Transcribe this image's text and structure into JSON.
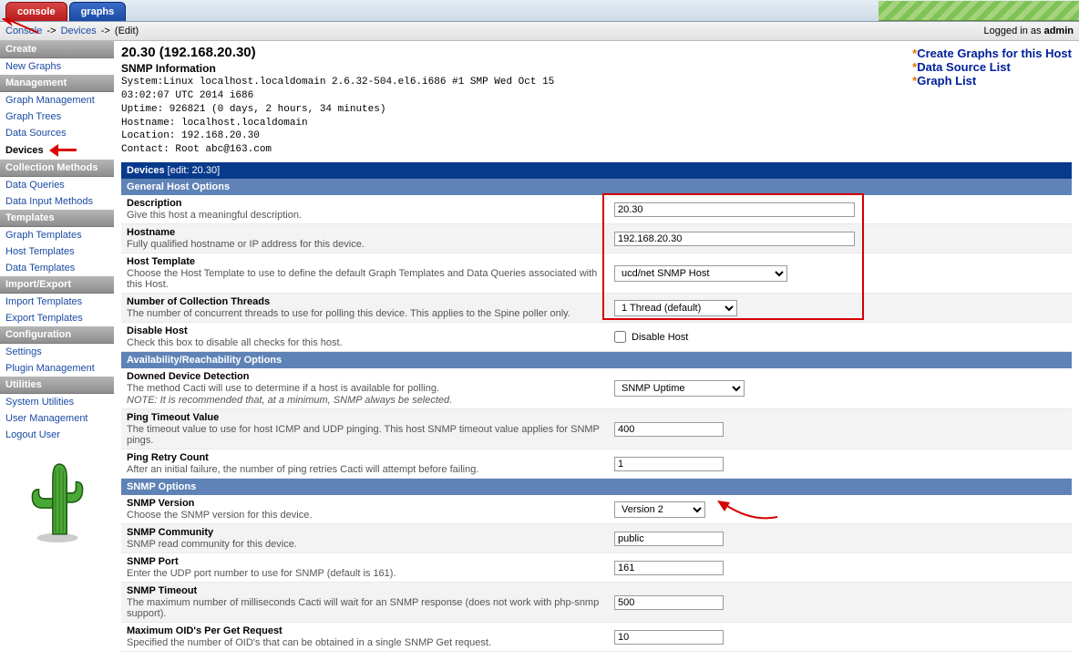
{
  "tabs": {
    "console": "console",
    "graphs": "graphs"
  },
  "breadcrumb": {
    "console": "Console",
    "sep": " -> ",
    "devices": "Devices",
    "edit": "(Edit)",
    "logged_in_as_prefix": "Logged in as ",
    "user": "admin"
  },
  "sidebar": {
    "create": "Create",
    "new_graphs": "New Graphs",
    "management": "Management",
    "graph_management": "Graph Management",
    "graph_trees": "Graph Trees",
    "data_sources": "Data Sources",
    "devices": "Devices",
    "collection_methods": "Collection Methods",
    "data_queries": "Data Queries",
    "data_input_methods": "Data Input Methods",
    "templates": "Templates",
    "graph_templates": "Graph Templates",
    "host_templates": "Host Templates",
    "data_templates": "Data Templates",
    "import_export": "Import/Export",
    "import_templates": "Import Templates",
    "export_templates": "Export Templates",
    "configuration": "Configuration",
    "settings": "Settings",
    "plugin_management": "Plugin Management",
    "utilities": "Utilities",
    "system_utilities": "System Utilities",
    "user_management": "User Management",
    "logout_user": "Logout User"
  },
  "host": {
    "title": "20.30 (192.168.20.30)",
    "snmp_info_title": "SNMP Information",
    "info_lines": "System:Linux localhost.localdomain 2.6.32-504.el6.i686 #1 SMP Wed Oct 15\n03:02:07 UTC 2014 i686\nUptime: 926821 (0 days, 2 hours, 34 minutes)\nHostname: localhost.localdomain\nLocation: 192.168.20.30\nContact: Root abc@163.com"
  },
  "actions": {
    "create_graphs": "Create Graphs for this Host",
    "data_source_list": "Data Source List",
    "graph_list": "Graph List"
  },
  "bars": {
    "devices_edit": "Devices",
    "devices_sub": " [edit: 20.30]",
    "general_host_options": "General Host Options",
    "availability": "Availability/Reachability Options",
    "snmp_options": "SNMP Options"
  },
  "fields": {
    "description": {
      "label": "Description",
      "desc": "Give this host a meaningful description.",
      "value": "20.30"
    },
    "hostname": {
      "label": "Hostname",
      "desc": "Fully qualified hostname or IP address for this device.",
      "value": "192.168.20.30"
    },
    "host_template": {
      "label": "Host Template",
      "desc": "Choose the Host Template to use to define the default Graph Templates and Data Queries associated with this Host.",
      "value": "ucd/net SNMP Host"
    },
    "threads": {
      "label": "Number of Collection Threads",
      "desc": "The number of concurrent threads to use for polling this device. This applies to the Spine poller only.",
      "value": "1 Thread (default)"
    },
    "disable_host": {
      "label": "Disable Host",
      "desc": "Check this box to disable all checks for this host.",
      "cb_label": "Disable Host"
    },
    "downed": {
      "label": "Downed Device Detection",
      "desc": "The method Cacti will use to determine if a host is available for polling.",
      "note": "NOTE: It is recommended that, at a minimum, SNMP always be selected.",
      "value": "SNMP Uptime"
    },
    "ping_timeout": {
      "label": "Ping Timeout Value",
      "desc": "The timeout value to use for host ICMP and UDP pinging. This host SNMP timeout value applies for SNMP pings.",
      "value": "400"
    },
    "ping_retry": {
      "label": "Ping Retry Count",
      "desc": "After an initial failure, the number of ping retries Cacti will attempt before failing.",
      "value": "1"
    },
    "snmp_version": {
      "label": "SNMP Version",
      "desc": "Choose the SNMP version for this device.",
      "value": "Version 2"
    },
    "snmp_community": {
      "label": "SNMP Community",
      "desc": "SNMP read community for this device.",
      "value": "public"
    },
    "snmp_port": {
      "label": "SNMP Port",
      "desc": "Enter the UDP port number to use for SNMP (default is 161).",
      "value": "161"
    },
    "snmp_timeout": {
      "label": "SNMP Timeout",
      "desc": "The maximum number of milliseconds Cacti will wait for an SNMP response (does not work with php-snmp support).",
      "value": "500"
    },
    "max_oids": {
      "label": "Maximum OID's Per Get Request",
      "desc": "Specified the number of OID's that can be obtained in a single SNMP Get request.",
      "value": "10"
    }
  }
}
